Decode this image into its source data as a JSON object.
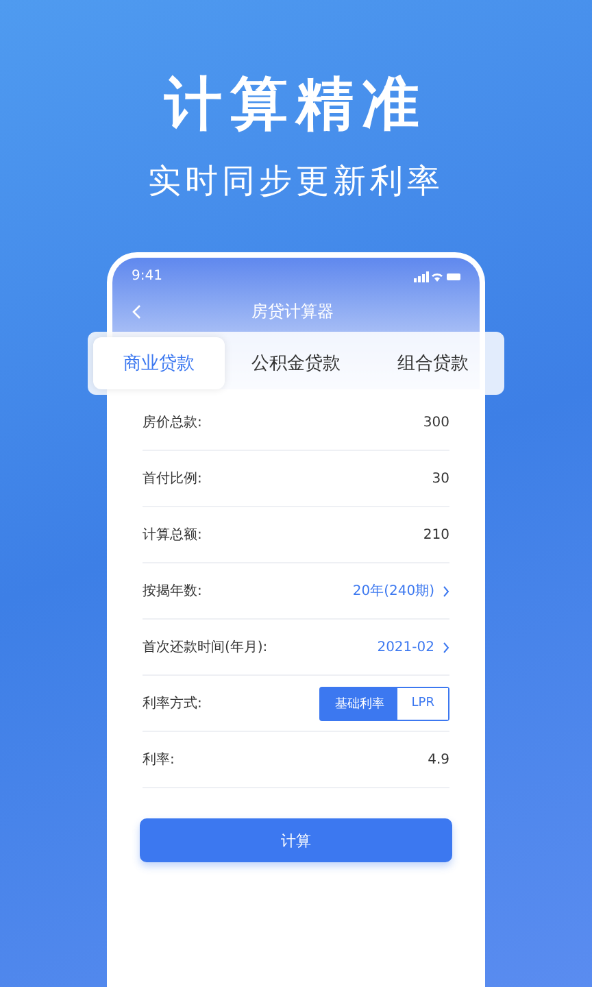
{
  "headline": "计算精准",
  "subheadline": "实时同步更新利率",
  "status_bar": {
    "time": "9:41"
  },
  "nav": {
    "title": "房贷计算器"
  },
  "tabs": [
    {
      "label": "商业贷款",
      "selected": true
    },
    {
      "label": "公积金贷款",
      "selected": false
    },
    {
      "label": "组合贷款",
      "selected": false
    }
  ],
  "rows": [
    {
      "kind": "value",
      "label": "房价总款:",
      "value": "300"
    },
    {
      "kind": "value",
      "label": "首付比例:",
      "value": "30"
    },
    {
      "kind": "value",
      "label": "计算总额:",
      "value": "210"
    },
    {
      "kind": "select",
      "label": "按揭年数:",
      "value": "20年(240期)"
    },
    {
      "kind": "select",
      "label": "首次还款时间(年月):",
      "value": "2021-02"
    },
    {
      "kind": "toggle",
      "label": "利率方式:",
      "options": [
        {
          "label": "基础利率",
          "selected": true
        },
        {
          "label": "LPR",
          "selected": false
        }
      ]
    },
    {
      "kind": "value",
      "label": "利率:",
      "value": "4.9"
    }
  ],
  "calculate_button": "计算"
}
